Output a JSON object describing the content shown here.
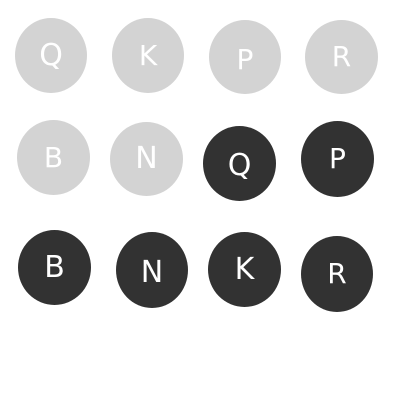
{
  "tokens": [
    {
      "letter": "Q",
      "shade": "light"
    },
    {
      "letter": "K",
      "shade": "light"
    },
    {
      "letter": "P",
      "shade": "light"
    },
    {
      "letter": "R",
      "shade": "light"
    },
    {
      "letter": "B",
      "shade": "light"
    },
    {
      "letter": "N",
      "shade": "light"
    },
    {
      "letter": "Q",
      "shade": "dark"
    },
    {
      "letter": "P",
      "shade": "dark"
    },
    {
      "letter": "B",
      "shade": "dark"
    },
    {
      "letter": "N",
      "shade": "dark"
    },
    {
      "letter": "K",
      "shade": "dark"
    },
    {
      "letter": "R",
      "shade": "dark"
    }
  ],
  "colors": {
    "light_token": "#d3d3d3",
    "dark_token": "#323232",
    "letter": "#ffffff",
    "background": "#ffffff"
  }
}
